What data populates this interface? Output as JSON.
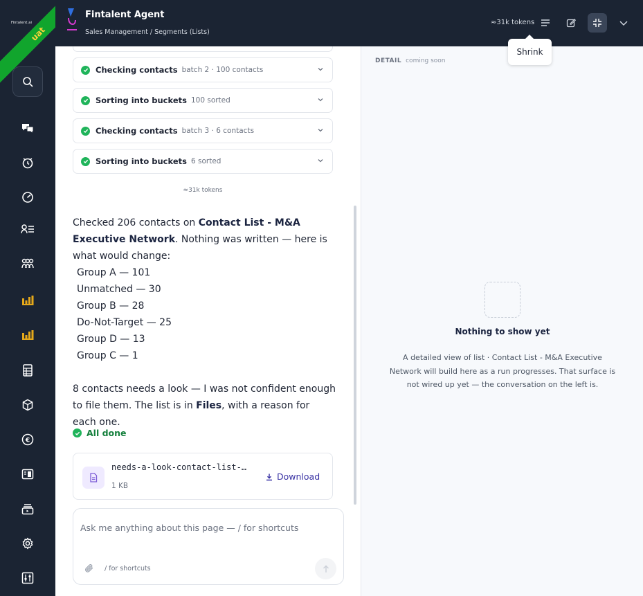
{
  "rail": {
    "brand": "Fintalent.ai",
    "env_badge": "uat",
    "nav": [
      "search-icon",
      "chat-icon",
      "timer-icon",
      "dashboard-gauge-icon",
      "contacts-list-icon",
      "team-icon",
      "bar-chart-icon",
      "bar-chart-icon-2",
      "spreadsheet-icon",
      "package-icon",
      "euro-icon",
      "layout-icon",
      "media-icon",
      "gear-icon",
      "sliders-icon"
    ],
    "accent": "#e5a81a"
  },
  "header": {
    "title": "Fintalent Agent",
    "breadcrumb": "Sales Management / Segments (Lists)",
    "tokens": "≈31k tokens",
    "tooltip": "Shrink"
  },
  "chat": {
    "steps": [
      {
        "label": "Checking contacts",
        "meta": "batch 2 · 100 contacts"
      },
      {
        "label": "Sorting into buckets",
        "meta": "100 sorted"
      },
      {
        "label": "Checking contacts",
        "meta": "batch 3 · 6 contacts"
      },
      {
        "label": "Sorting into buckets",
        "meta": "6 sorted"
      }
    ],
    "token_note": "≈31k tokens",
    "message": {
      "intro_pre": "Checked 206 contacts on ",
      "list_name": "Contact List - M&A Executive Network",
      "intro_post": ". Nothing was written — here is what would change:",
      "groups": [
        "Group A — 101",
        "Unmatched — 30",
        "Group B — 28",
        "Do-Not-Target — 25",
        "Group D — 13",
        "Group C — 1"
      ],
      "followup_pre": "8 contacts needs a look — I was not confident enough to file them. The list is in ",
      "followup_link": "Files",
      "followup_post": ", with a reason for each one."
    },
    "done_label": "All done",
    "file": {
      "name": "needs-a-look-contact-list-…",
      "size": "1 KB",
      "download_label": "Download"
    },
    "composer": {
      "placeholder": "Ask me anything about this page — / for shortcuts",
      "hint": "/ for shortcuts"
    }
  },
  "detail": {
    "heading": "DETAIL",
    "subheading": "coming soon",
    "empty_title": "Nothing to show yet",
    "empty_desc": "A detailed view of list · Contact List - M&A Executive Network will build here as a run progresses. That surface is not wired up yet — the conversation on the left is."
  },
  "colors": {
    "rail_bg": "#1b2433",
    "success": "#1fb45a",
    "link": "#3730a3",
    "ribbon": "#11a52d"
  }
}
